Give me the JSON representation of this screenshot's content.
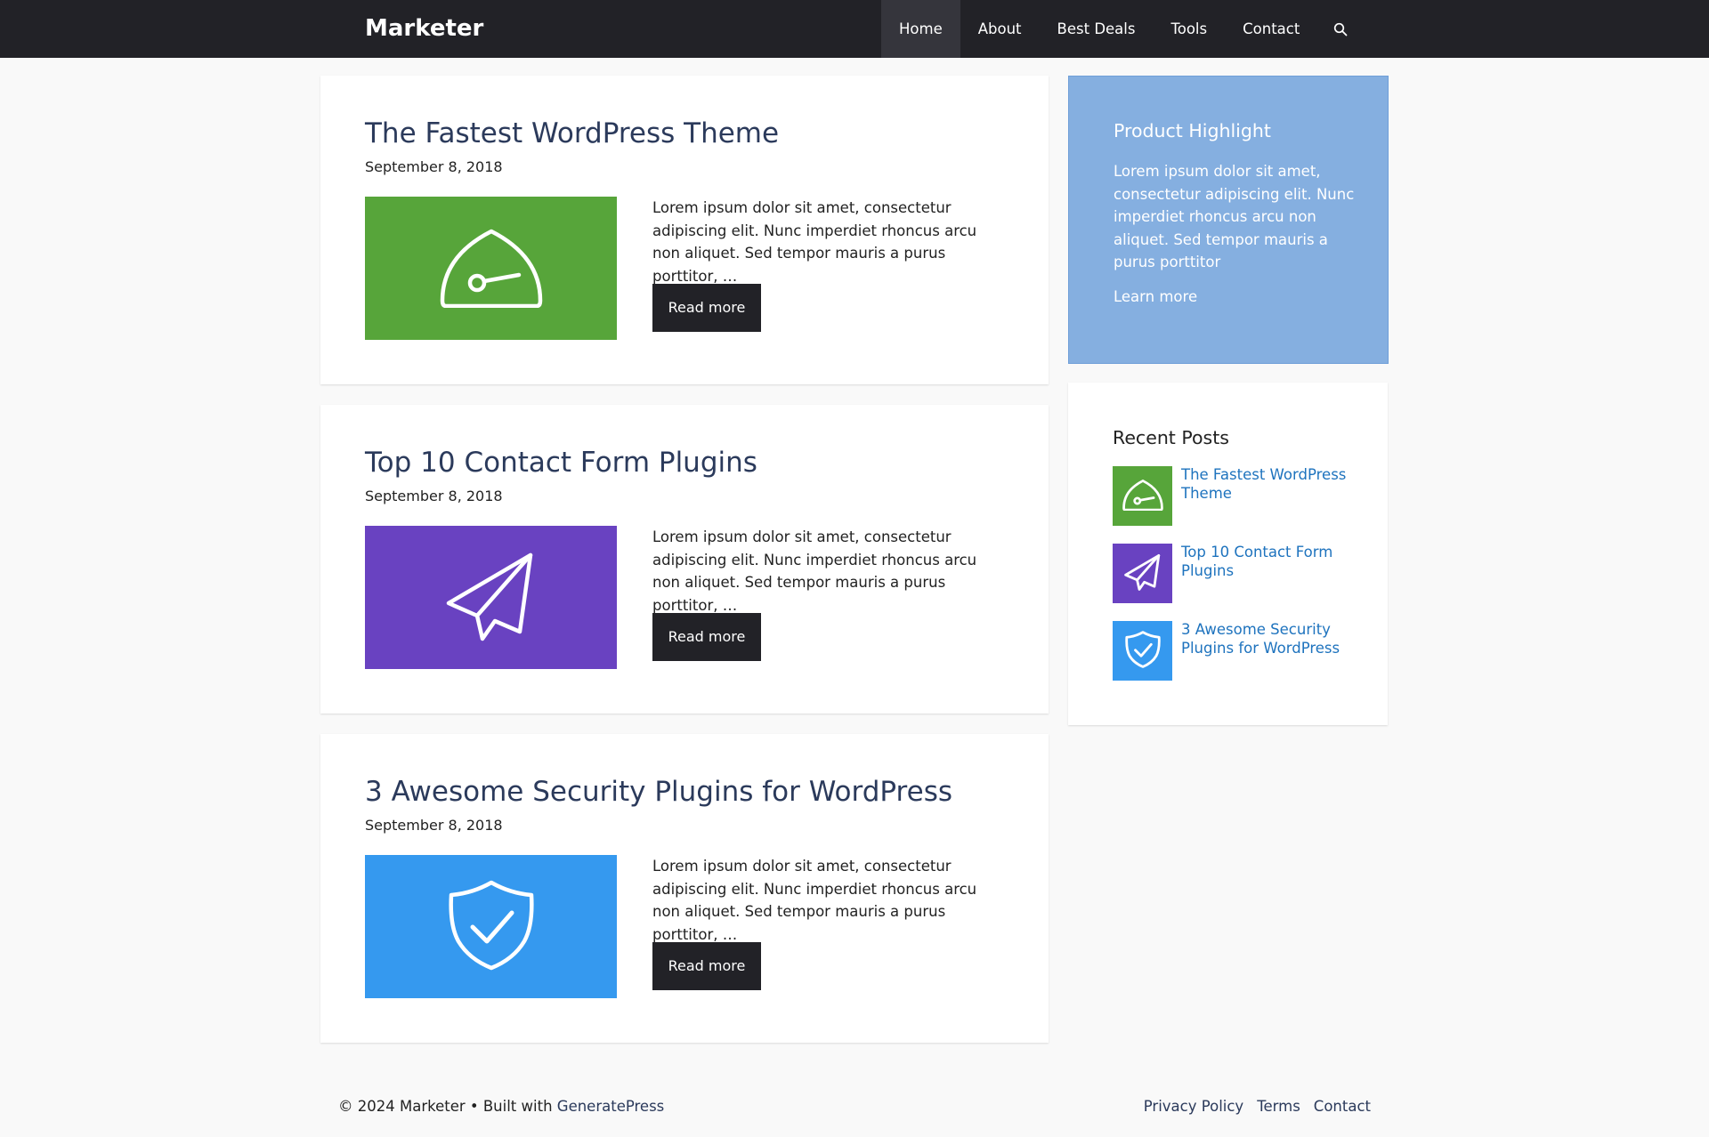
{
  "header": {
    "site_title": "Marketer",
    "nav": [
      {
        "label": "Home",
        "active": true
      },
      {
        "label": "About",
        "active": false
      },
      {
        "label": "Best Deals",
        "active": false
      },
      {
        "label": "Tools",
        "active": false
      },
      {
        "label": "Contact",
        "active": false
      }
    ],
    "search_icon": "search-icon"
  },
  "posts": [
    {
      "title": "The Fastest WordPress Theme",
      "date": "September 8, 2018",
      "excerpt": "Lorem ipsum dolor sit amet, consectetur adipiscing elit. Nunc imperdiet rhoncus arcu non aliquet. Sed tempor mauris a purus porttitor, …",
      "read_more": "Read more",
      "thumb_color": "#57a53a",
      "icon": "speedometer-icon"
    },
    {
      "title": "Top 10 Contact Form Plugins",
      "date": "September 8, 2018",
      "excerpt": "Lorem ipsum dolor sit amet, consectetur adipiscing elit. Nunc imperdiet rhoncus arcu non aliquet. Sed tempor mauris a purus porttitor, …",
      "read_more": "Read more",
      "thumb_color": "#6942c1",
      "icon": "paper-plane-icon"
    },
    {
      "title": "3 Awesome Security Plugins for WordPress",
      "date": "September 8, 2018",
      "excerpt": "Lorem ipsum dolor sit amet, consectetur adipiscing elit. Nunc imperdiet rhoncus arcu non aliquet. Sed tempor mauris a purus porttitor, …",
      "read_more": "Read more",
      "thumb_color": "#3599ef",
      "icon": "shield-check-icon"
    }
  ],
  "sidebar": {
    "highlight": {
      "title": "Product Highlight",
      "text": "Lorem ipsum dolor sit amet, consectetur adipiscing elit. Nunc imperdiet rhoncus arcu non aliquet. Sed tempor mauris a purus porttitor",
      "link": "Learn more",
      "bg_color": "#85afe0"
    },
    "recent": {
      "title": "Recent Posts",
      "items": [
        {
          "label": "The Fastest WordPress Theme",
          "thumb_color": "#57a53a",
          "icon": "speedometer-icon"
        },
        {
          "label": "Top 10 Contact Form Plugins",
          "thumb_color": "#6942c1",
          "icon": "paper-plane-icon"
        },
        {
          "label": "3 Awesome Security Plugins for WordPress",
          "thumb_color": "#3599ef",
          "icon": "shield-check-icon"
        }
      ]
    }
  },
  "footer": {
    "copyright": "© 2024 Marketer • Built with ",
    "builder_link": "GeneratePress",
    "nav": [
      "Privacy Policy",
      "Terms",
      "Contact"
    ]
  },
  "colors": {
    "header_bg": "#222227",
    "title_color": "#2b3a5b",
    "link_color": "#1e73be",
    "button_bg": "#222227"
  }
}
